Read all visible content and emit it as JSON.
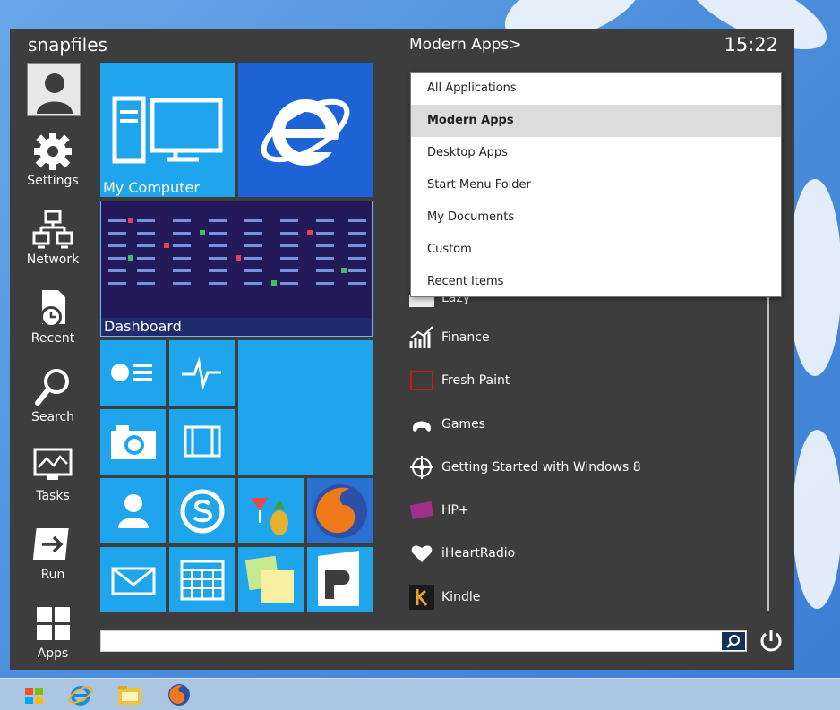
{
  "header": {
    "user": "snapfiles",
    "breadcrumb": "Modern Apps>",
    "time": "15:22"
  },
  "rail": [
    {
      "label": "Settings",
      "icon": "gear-icon"
    },
    {
      "label": "Network",
      "icon": "network-icon"
    },
    {
      "label": "Recent",
      "icon": "recent-icon"
    },
    {
      "label": "Search",
      "icon": "search-icon"
    },
    {
      "label": "Tasks",
      "icon": "tasks-icon"
    },
    {
      "label": "Run",
      "icon": "run-icon"
    },
    {
      "label": "Apps",
      "icon": "apps-icon"
    }
  ],
  "tiles": {
    "my_computer": "My Computer",
    "dashboard": "Dashboard"
  },
  "dropdown": {
    "items": [
      "All Applications",
      "Modern Apps",
      "Desktop Apps",
      "Start Menu Folder",
      "My Documents",
      "Custom",
      "Recent Items"
    ],
    "selected": "Modern Apps"
  },
  "apps": [
    {
      "label": "Finance",
      "icon": "finance-icon"
    },
    {
      "label": "Fresh Paint",
      "icon": "fresh-paint-icon"
    },
    {
      "label": "Games",
      "icon": "games-icon"
    },
    {
      "label": "Getting Started with Windows 8",
      "icon": "compass-icon"
    },
    {
      "label": "HP+",
      "icon": "hp-icon"
    },
    {
      "label": "iHeartRadio",
      "icon": "iheartradio-icon"
    },
    {
      "label": "Kindle",
      "icon": "kindle-icon"
    }
  ],
  "partial_row": "Lazy",
  "colors": {
    "tile_blue": "#1ea5ec",
    "panel": "#3d3d3d",
    "ie_tile": "#1e63d6"
  }
}
